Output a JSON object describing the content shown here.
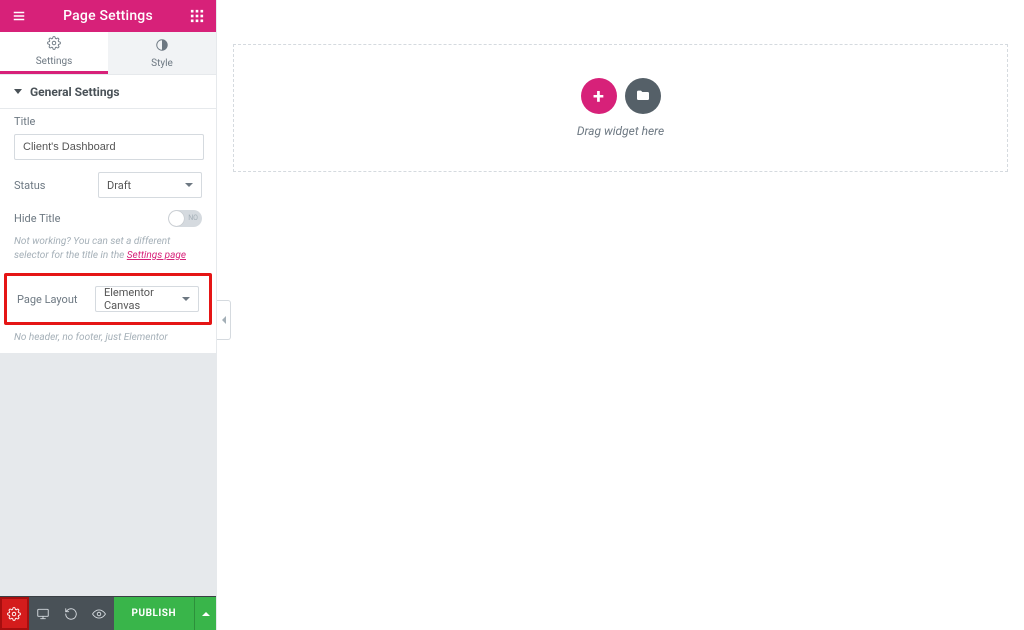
{
  "header": {
    "title": "Page Settings"
  },
  "tabs": {
    "settings": {
      "label": "Settings"
    },
    "style": {
      "label": "Style"
    }
  },
  "section": {
    "title": "General Settings"
  },
  "fields": {
    "title": {
      "label": "Title",
      "value": "Client's Dashboard"
    },
    "status": {
      "label": "Status",
      "value": "Draft"
    },
    "hide_title": {
      "label": "Hide Title",
      "toggle_label": "NO",
      "desc_prefix": "Not working? You can set a different selector for the title in the ",
      "desc_link": "Settings page"
    },
    "page_layout": {
      "label": "Page Layout",
      "value": "Elementor Canvas",
      "desc": "No header, no footer, just Elementor"
    }
  },
  "footer": {
    "publish": "PUBLISH"
  },
  "canvas": {
    "drag_text": "Drag widget here"
  }
}
